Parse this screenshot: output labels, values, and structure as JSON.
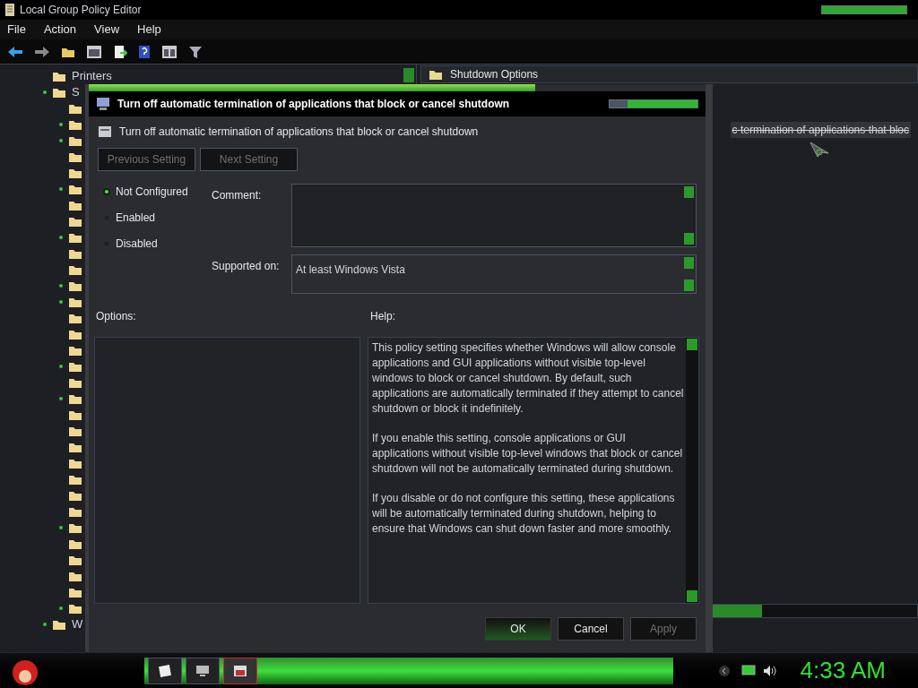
{
  "window": {
    "title": "Local Group Policy Editor"
  },
  "menu": [
    "File",
    "Action",
    "View",
    "Help"
  ],
  "tree": {
    "items": [
      {
        "label": "Printers",
        "expandable": false
      },
      {
        "label": "S",
        "expandable": true,
        "children": [
          {
            "expandable": false
          },
          {
            "expandable": true
          },
          {
            "expandable": true
          },
          {
            "expandable": false
          },
          {
            "expandable": false
          },
          {
            "expandable": true
          },
          {
            "expandable": false
          },
          {
            "expandable": false
          },
          {
            "expandable": true
          },
          {
            "expandable": false
          },
          {
            "expandable": false
          },
          {
            "expandable": true
          },
          {
            "expandable": true
          },
          {
            "expandable": false
          },
          {
            "expandable": false
          },
          {
            "expandable": false
          },
          {
            "expandable": true
          },
          {
            "expandable": false
          },
          {
            "expandable": true
          },
          {
            "expandable": false
          },
          {
            "expandable": false
          },
          {
            "expandable": false
          },
          {
            "expandable": false
          },
          {
            "expandable": false
          },
          {
            "expandable": false
          },
          {
            "expandable": false
          },
          {
            "expandable": true
          },
          {
            "expandable": false
          },
          {
            "expandable": false
          },
          {
            "expandable": false
          },
          {
            "expandable": false
          },
          {
            "expandable": true
          }
        ]
      },
      {
        "label": "W",
        "expandable": true
      }
    ]
  },
  "details": {
    "header": "Shutdown Options",
    "rows": [
      {
        "text": "c termination of applications that bloc",
        "selected": true
      }
    ]
  },
  "dialog": {
    "title": "Turn off automatic termination of applications that block or cancel shutdown",
    "heading": "Turn off automatic termination of applications that block or cancel shutdown",
    "nav_buttons": [
      {
        "label": "Previous Setting",
        "disabled": true
      },
      {
        "label": "Next Setting",
        "disabled": true
      }
    ],
    "states": [
      {
        "label": "Not Configured",
        "selected": true
      },
      {
        "label": "Enabled",
        "selected": false
      },
      {
        "label": "Disabled",
        "selected": false
      }
    ],
    "comment_label": "Comment:",
    "supported_label": "Supported on:",
    "supported_value": "At least Windows Vista",
    "options_label": "Options:",
    "help_label": "Help:",
    "help_paragraphs": [
      "This policy setting specifies whether Windows will allow console applications and GUI applications without visible top-level windows to block or cancel shutdown. By default, such applications are automatically terminated if they attempt to cancel shutdown or block it indefinitely.",
      "If you enable this setting, console applications or GUI applications without visible top-level windows that block or cancel shutdown will not be automatically terminated during shutdown.",
      "If you disable or do not configure this setting, these applications will be automatically terminated during shutdown, helping to ensure that Windows can shut down faster and more smoothly."
    ],
    "buttons": [
      {
        "label": "OK",
        "disabled": false,
        "default": true
      },
      {
        "label": "Cancel",
        "disabled": false,
        "default": false
      },
      {
        "label": "Apply",
        "disabled": true,
        "default": false
      }
    ]
  },
  "taskbar": {
    "clock": "4:33 AM"
  }
}
